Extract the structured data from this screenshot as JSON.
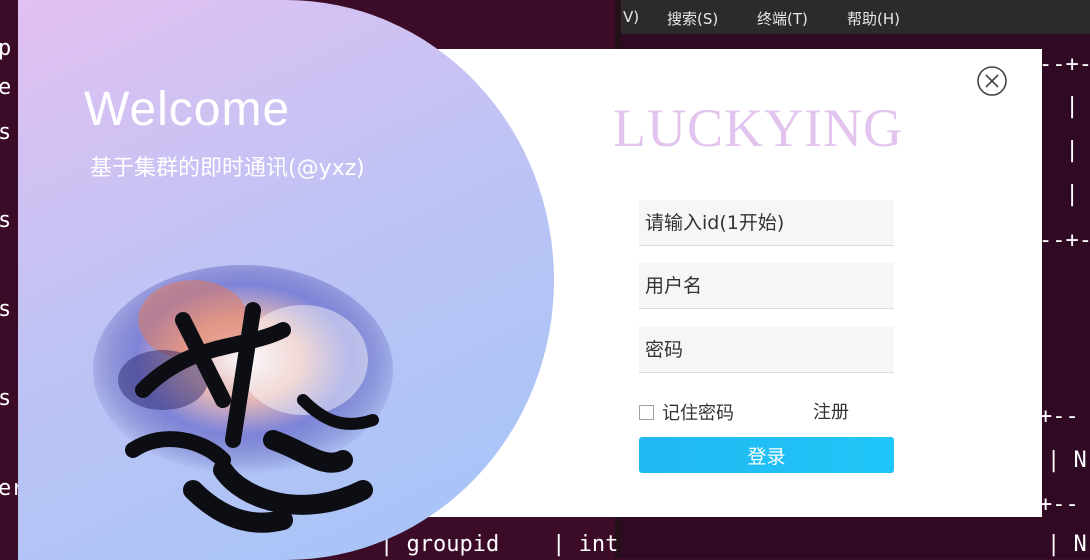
{
  "terminal": {
    "menu": [
      "V)",
      "搜索(S)",
      "终端(T)",
      "帮助(H)"
    ],
    "left_fragments": [
      "p",
      "e",
      "s",
      "s",
      "s",
      "s",
      "er"
    ],
    "right_rows": [
      "--+-",
      "  |",
      "  |",
      "  |",
      "--+-",
      "+--",
      "| N",
      "+--",
      "| N"
    ],
    "bottom_row": "| groupid    | int"
  },
  "dialog": {
    "welcome": "Welcome",
    "subtitle": "基于集群的即时通讯(@yxz)",
    "brand": "LUCKYING",
    "id_placeholder": "请输入id(1开始)",
    "username_placeholder": "用户名",
    "password_placeholder": "密码",
    "remember_label": "记住密码",
    "register_label": "注册",
    "login_label": "登录",
    "close_icon": "close-icon",
    "art_icon": "ink-art-image"
  },
  "colors": {
    "accent": "#1fc6f8",
    "brand": "#e3c4ee",
    "terminal_bg": "#300a24"
  }
}
